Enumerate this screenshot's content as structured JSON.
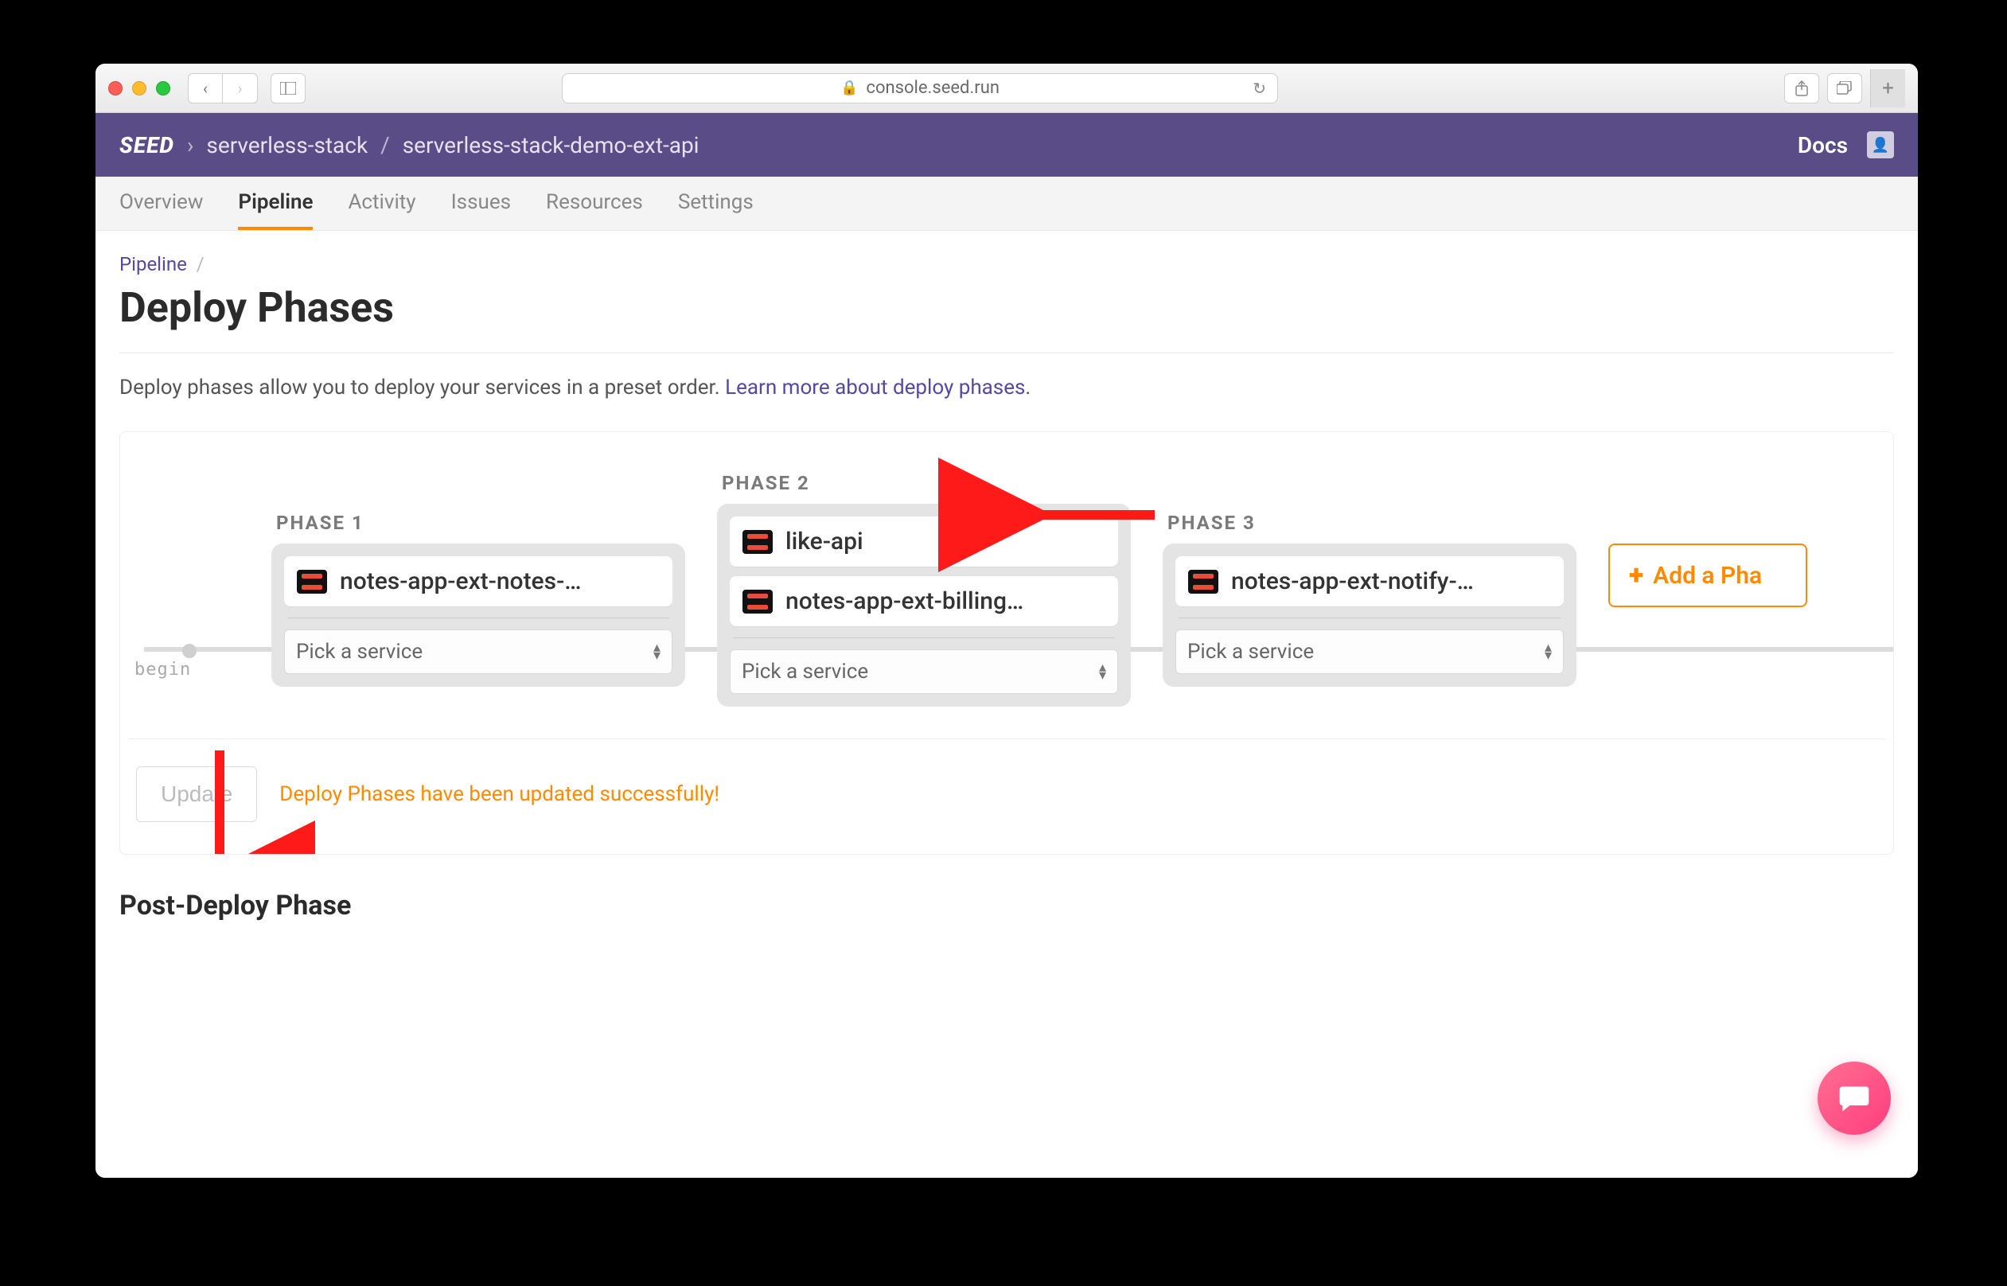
{
  "browser": {
    "url": "console.seed.run"
  },
  "header": {
    "logo": "SEED",
    "org": "serverless-stack",
    "app": "serverless-stack-demo-ext-api",
    "docs_label": "Docs"
  },
  "tabs": {
    "items": [
      "Overview",
      "Pipeline",
      "Activity",
      "Issues",
      "Resources",
      "Settings"
    ],
    "active_index": 1
  },
  "breadcrumb": {
    "root": "Pipeline"
  },
  "page": {
    "title": "Deploy Phases",
    "desc_prefix": "Deploy phases allow you to deploy your services in a preset order. ",
    "desc_link": "Learn more about deploy phases",
    "desc_suffix": "."
  },
  "board": {
    "begin_label": "begin",
    "phases": [
      {
        "label": "PHASE 1",
        "services": [
          "notes-app-ext-notes-…"
        ],
        "picker": "Pick a service"
      },
      {
        "label": "PHASE 2",
        "services": [
          "like-api",
          "notes-app-ext-billing…"
        ],
        "picker": "Pick a service"
      },
      {
        "label": "PHASE 3",
        "services": [
          "notes-app-ext-notify-…"
        ],
        "picker": "Pick a service"
      }
    ],
    "add_phase_label": "Add a Pha",
    "update_label": "Update",
    "success_msg": "Deploy Phases have been updated successfully!"
  },
  "post_deploy_title": "Post-Deploy Phase"
}
